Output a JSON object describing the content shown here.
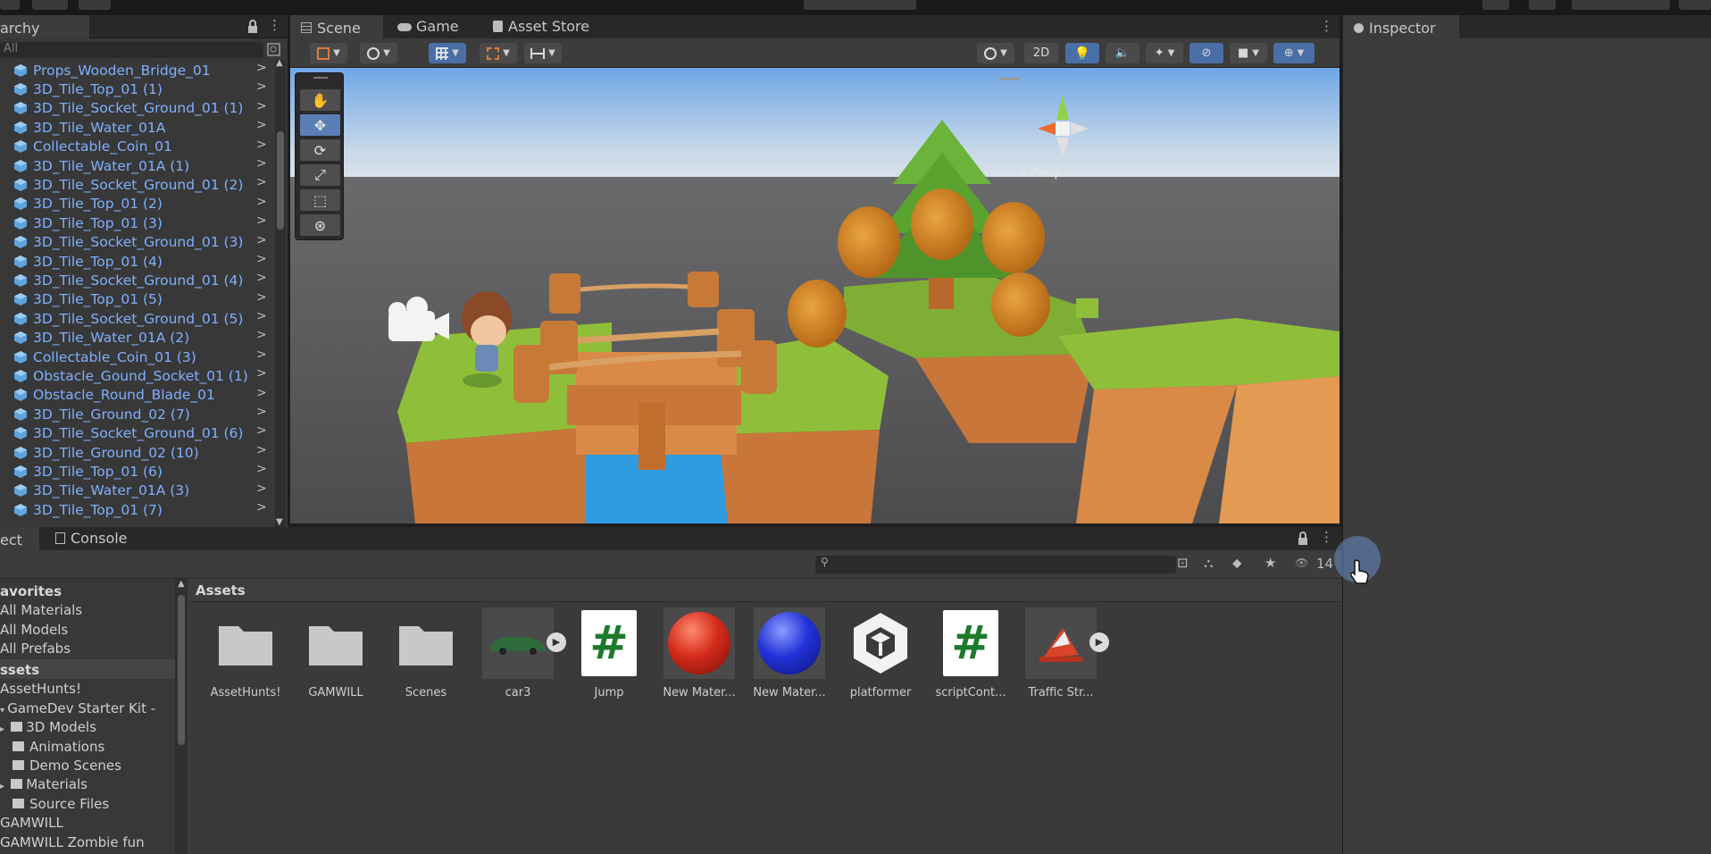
{
  "hierarchy": {
    "tab_label": "archy",
    "search_placeholder": "All",
    "items": [
      "Props_Wooden_Bridge_01",
      "3D_Tile_Top_01 (1)",
      "3D_Tile_Socket_Ground_01 (1)",
      "3D_Tile_Water_01A",
      "Collectable_Coin_01",
      "3D_Tile_Water_01A (1)",
      "3D_Tile_Socket_Ground_01 (2)",
      "3D_Tile_Top_01 (2)",
      "3D_Tile_Top_01 (3)",
      "3D_Tile_Socket_Ground_01 (3)",
      "3D_Tile_Top_01 (4)",
      "3D_Tile_Socket_Ground_01 (4)",
      "3D_Tile_Top_01 (5)",
      "3D_Tile_Socket_Ground_01 (5)",
      "3D_Tile_Water_01A (2)",
      "Collectable_Coin_01 (3)",
      "Obstacle_Gound_Socket_01 (1)",
      "Obstacle_Round_Blade_01",
      "3D_Tile_Ground_02 (7)",
      "3D_Tile_Socket_Ground_01 (6)",
      "3D_Tile_Ground_02 (10)",
      "3D_Tile_Top_01 (6)",
      "3D_Tile_Water_01A (3)",
      "3D_Tile_Top_01 (7)"
    ]
  },
  "scene": {
    "tabs": [
      {
        "label": "Scene",
        "icon": "scene-icon"
      },
      {
        "label": "Game",
        "icon": "gamepad-icon"
      },
      {
        "label": "Asset Store",
        "icon": "bag-icon"
      }
    ],
    "toggle_2d": "2D",
    "gizmo_label": "< Persp"
  },
  "inspector": {
    "tab_label": "Inspector"
  },
  "project": {
    "tabs": [
      {
        "label": "ect"
      },
      {
        "label": "Console"
      }
    ],
    "visible_count": "14",
    "favorites": {
      "header": "avorites",
      "items": [
        "All Materials",
        "All Models",
        "All Prefabs"
      ]
    },
    "assets_tree": {
      "header": "ssets",
      "items": [
        {
          "label": "AssetHunts!"
        },
        {
          "label": "GameDev Starter Kit -"
        },
        {
          "label": "3D Models"
        },
        {
          "label": "Animations"
        },
        {
          "label": "Demo Scenes"
        },
        {
          "label": "Materials"
        },
        {
          "label": "Source Files"
        },
        {
          "label": "GAMWILL"
        },
        {
          "label": "GAMWILL Zombie fun"
        }
      ]
    },
    "breadcrumb": "Assets",
    "assets": [
      {
        "label": "AssetHunts!",
        "type": "folder"
      },
      {
        "label": "GAMWILL",
        "type": "folder"
      },
      {
        "label": "Scenes",
        "type": "folder"
      },
      {
        "label": "car3",
        "type": "prefab"
      },
      {
        "label": "Jump",
        "type": "script"
      },
      {
        "label": "New Mater...",
        "type": "material-red"
      },
      {
        "label": "New Mater...",
        "type": "material-blue"
      },
      {
        "label": "platformer",
        "type": "unity-scene"
      },
      {
        "label": "scriptCont...",
        "type": "script"
      },
      {
        "label": "Traffic Str...",
        "type": "prefab"
      }
    ]
  },
  "colors": {
    "accent": "#4a6fa6",
    "hierarchy_text": "#7fb0ff",
    "script_hash": "#1d7a2c"
  }
}
